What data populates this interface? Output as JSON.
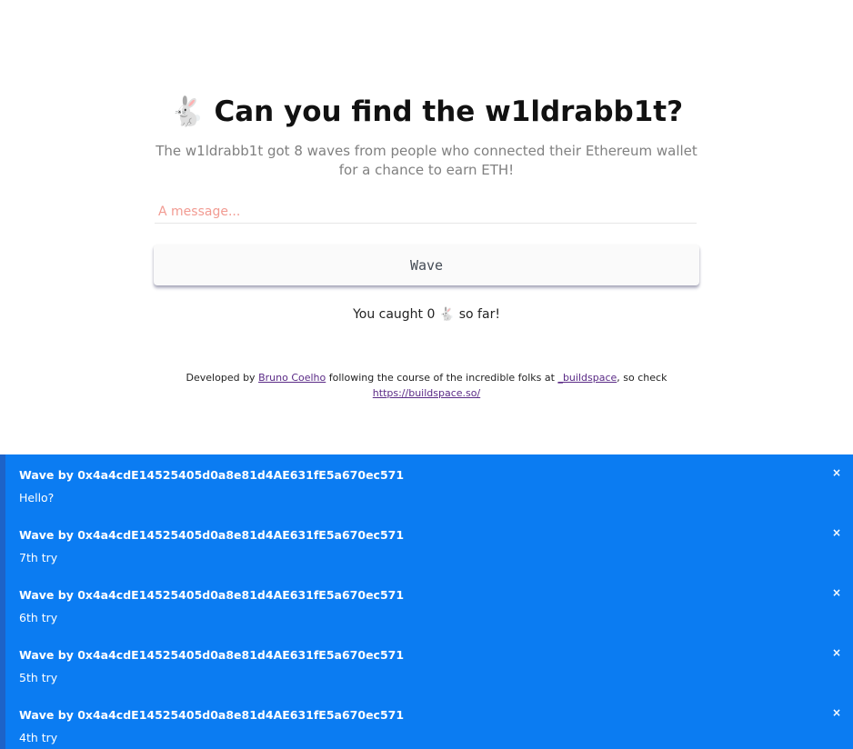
{
  "header": {
    "emoji": "🐇",
    "title": "Can you find the w1ldrabb1t?",
    "subtitle": "The w1ldrabb1t got 8 waves from people who connected their Ethereum wallet for a chance to earn ETH!"
  },
  "form": {
    "placeholder": "A message...",
    "value": "",
    "button_label": "Wave"
  },
  "caught": {
    "prefix": "You caught 0",
    "emoji": "🐇",
    "suffix": "so far!"
  },
  "footer": {
    "text1": "Developed by ",
    "author_link": "Bruno Coelho",
    "text2": " following the course of the incredible folks at ",
    "buildspace_link": "_buildspace",
    "text3": ", so check ",
    "url_link": "https://buildspace.so/"
  },
  "waves": [
    {
      "from": "Wave by 0x4a4cdE14525405d0a8e81d4AE631fE5a670ec571",
      "message": "Hello?",
      "close": "×"
    },
    {
      "from": "Wave by 0x4a4cdE14525405d0a8e81d4AE631fE5a670ec571",
      "message": "7th try",
      "close": "×"
    },
    {
      "from": "Wave by 0x4a4cdE14525405d0a8e81d4AE631fE5a670ec571",
      "message": "6th try",
      "close": "×"
    },
    {
      "from": "Wave by 0x4a4cdE14525405d0a8e81d4AE631fE5a670ec571",
      "message": "5th try",
      "close": "×"
    },
    {
      "from": "Wave by 0x4a4cdE14525405d0a8e81d4AE631fE5a670ec571",
      "message": "4th try",
      "close": "×"
    }
  ],
  "colors": {
    "wave_panel": "#0b7cf2",
    "placeholder": "#f29b92",
    "link": "#5a2a86"
  }
}
